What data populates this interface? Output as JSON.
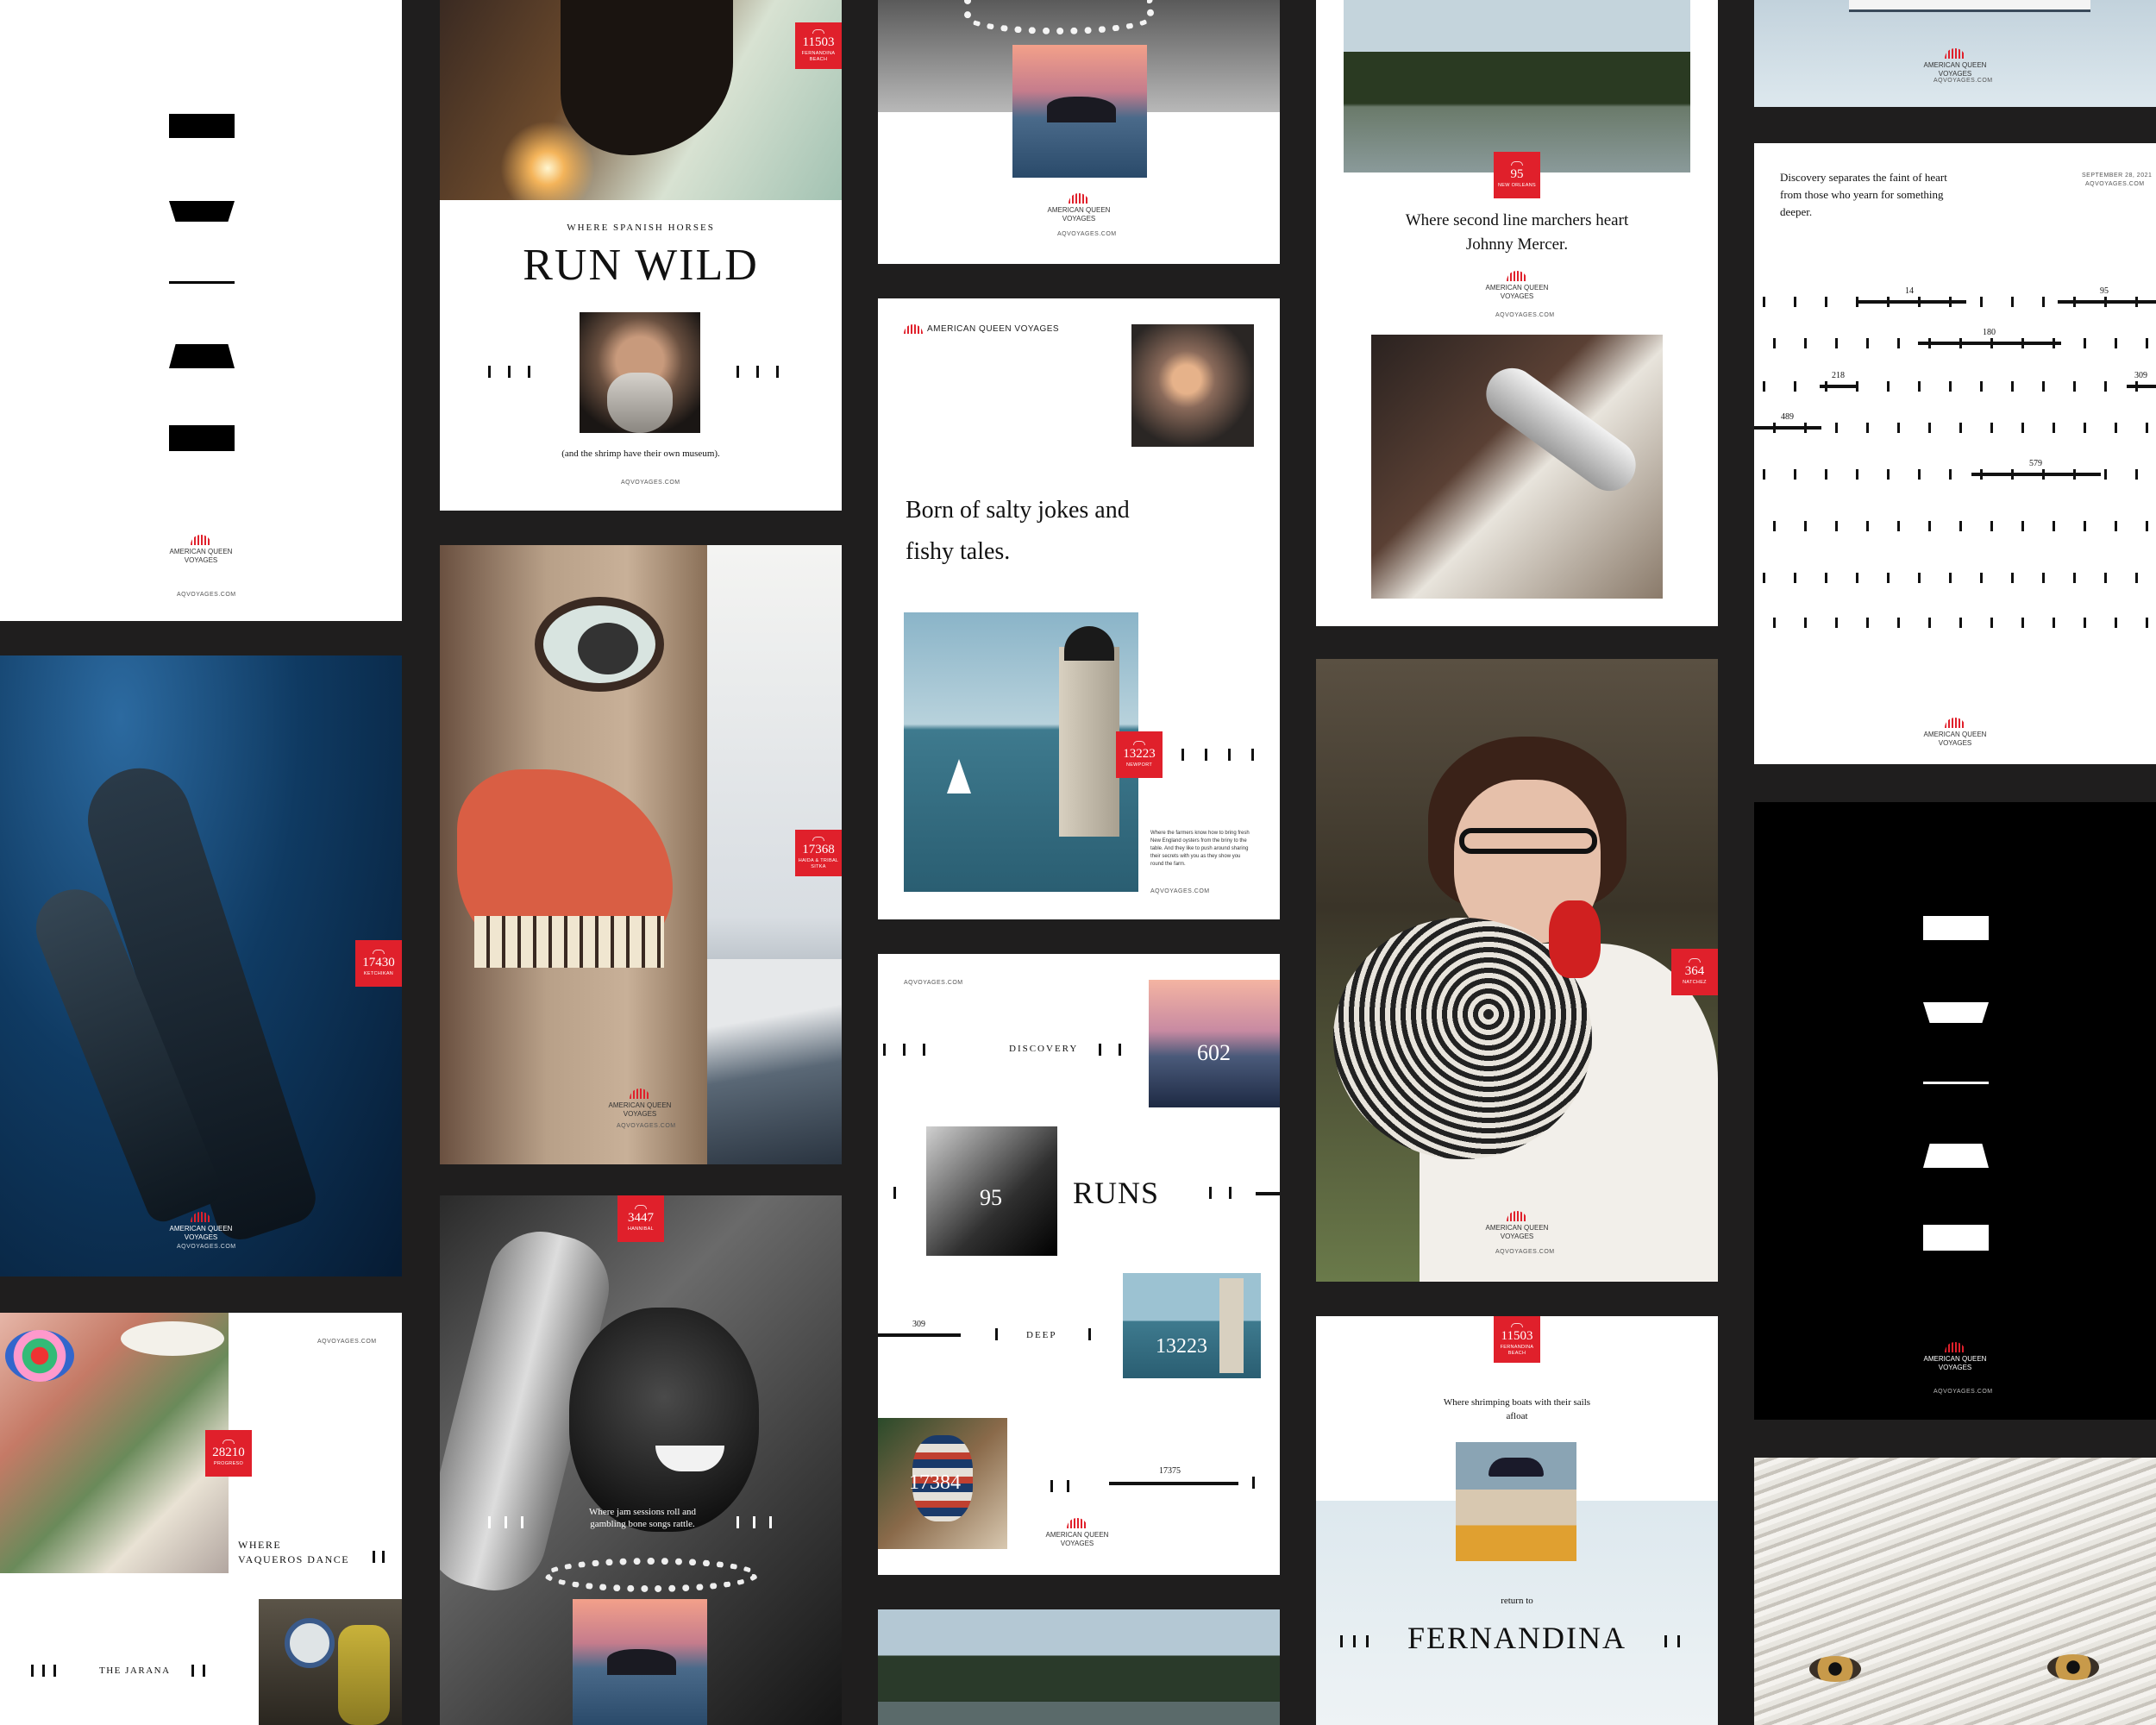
{
  "colors": {
    "background": "#1f1e1e",
    "brand_red": "#e0202b",
    "panel": "#ffffff",
    "panel_dark": "#000000"
  },
  "brand": {
    "name_line1": "AMERICAN QUEEN",
    "name_line2": "VOYAGES",
    "name_full": "AMERICAN QUEEN VOYAGES",
    "url": "AQVOYAGES.COM"
  },
  "p_horse": {
    "badge_num": "11503",
    "badge_place": "FERNANDINA BEACH",
    "kicker": "WHERE SPANISH HORSES",
    "headline": "RUN WILD",
    "caption": "(and the shrimp have their own museum)."
  },
  "p_whale": {
    "badge_num": "17430",
    "badge_place": "KETCHIKAN"
  },
  "p_vaqueros": {
    "badge_num": "28210",
    "badge_place": "PROGRESO",
    "headline_line1": "WHERE",
    "headline_line2": "VAQUEROS DANCE",
    "subhead": "THE JARANA"
  },
  "p_totem": {
    "badge_num": "17368",
    "badge_place": "HAIDA & TRIBAL SITKA"
  },
  "p_sax": {
    "badge_num": "3447",
    "badge_place": "HANNIBAL",
    "text": "Where jam sessions roll and gambling bone songs rattle."
  },
  "p_oyster": {
    "headline": "Born of salty jokes and fishy tales.",
    "badge_num": "13223",
    "badge_place": "NEWPORT",
    "body": "Where the farmers know how to bring fresh New England oysters from the briny to the table. And they like to push around sharing their secrets with you as they show you round the farm."
  },
  "p_discovery": {
    "word1": "DISCOVERY",
    "word2": "RUNS",
    "word3": "DEEP",
    "n602": "602",
    "n95": "95",
    "n309": "309",
    "n13223": "13223",
    "n17384": "17384",
    "n17375": "17375"
  },
  "p_trumpet": {
    "badge_num": "95",
    "badge_place": "NEW ORLEANS",
    "headline": "Where second line marchers heart Johnny Mercer."
  },
  "p_rooster": {
    "badge_num": "364",
    "badge_place": "NATCHEZ"
  },
  "p_fernandina": {
    "badge_num": "11503",
    "badge_place": "FERNANDINA BEACH",
    "kicker": "Where shrimping boats with their sails afloat",
    "return": "return to",
    "headline": "FERNANDINA"
  },
  "p_map": {
    "intro": "Discovery separates the faint of heart from those who yearn for something deeper.",
    "date": "SEPTEMBER 28, 2021",
    "labels": [
      "14",
      "95",
      "180",
      "218",
      "309",
      "489",
      "579"
    ]
  }
}
